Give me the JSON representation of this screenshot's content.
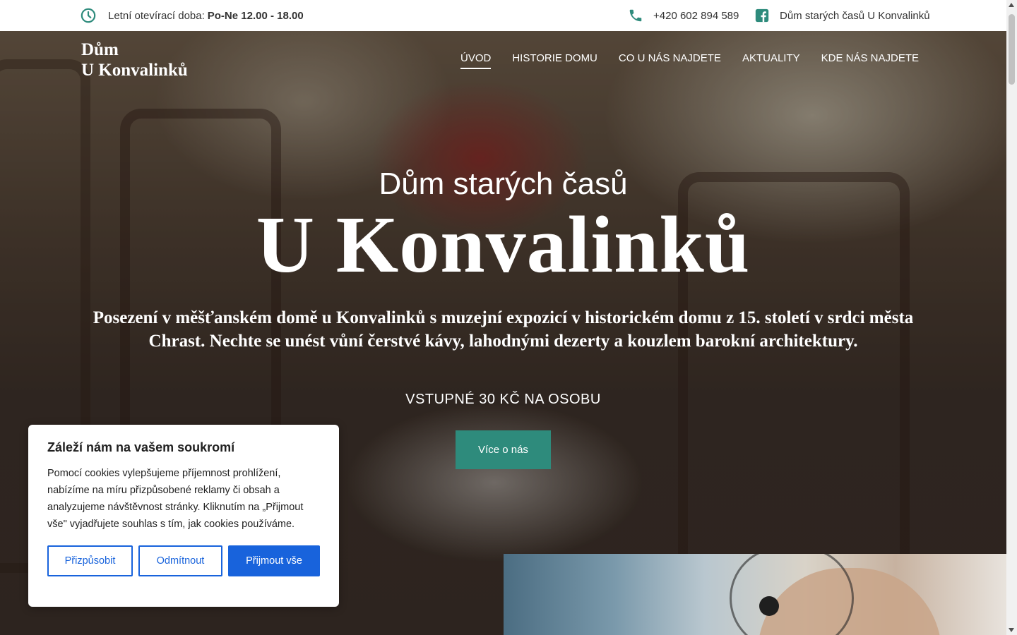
{
  "topbar": {
    "hours_label": "Letní otevírací doba:",
    "hours_value": "Po-Ne 12.00 - 18.00",
    "phone": "+420 602 894 589",
    "facebook": "Dům starých časů U Konvalinků",
    "icons": [
      "clock-icon",
      "phone-icon",
      "facebook-icon"
    ],
    "accent_color": "#2e8b7c"
  },
  "header": {
    "logo_line1": "Dům",
    "logo_line2": "U Konvalinků",
    "nav": [
      {
        "label": "ÚVOD",
        "active": true
      },
      {
        "label": "HISTORIE DOMU",
        "active": false
      },
      {
        "label": "CO U NÁS NAJDETE",
        "active": false
      },
      {
        "label": "AKTUALITY",
        "active": false
      },
      {
        "label": "KDE NÁS NAJDETE",
        "active": false
      }
    ]
  },
  "hero": {
    "subtitle": "Dům starých časů",
    "title": "U Konvalinků",
    "description": "Posezení v měšťanském domě u Konvalinků s muzejní expozicí v historickém domu z 15. století v srdci města Chrast. Nechte se unést vůní čerstvé kávy, lahodnými dezerty a kouzlem barokní architektury.",
    "price": "VSTUPNÉ 30 KČ NA OSOBU",
    "button": "Více o nás",
    "button_color": "#2e8b7c"
  },
  "cookie": {
    "title": "Záleží nám na vašem soukromí",
    "text": "Pomocí cookies vylepšujeme příjemnost prohlížení, nabízíme na míru přizpůsobené reklamy či obsah a analyzujeme návštěvnost stránky. Kliknutím na „Přijmout vše\" vyjadřujete souhlas s tím, jak cookies používáme.",
    "btn_customize": "Přizpůsobit",
    "btn_reject": "Odmítnout",
    "btn_accept": "Přijmout vše",
    "accent_color": "#1863dc"
  }
}
